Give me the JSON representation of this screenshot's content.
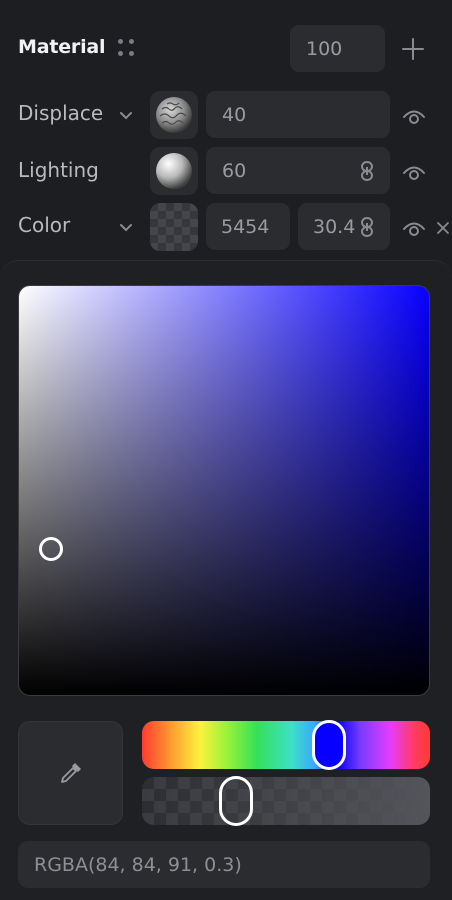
{
  "header": {
    "title": "Material",
    "value": "100"
  },
  "rows": [
    {
      "label": "Displace",
      "value": "40"
    },
    {
      "label": "Lighting",
      "value": "60"
    },
    {
      "label": "Color",
      "value": "5454",
      "opacity": "30.4"
    }
  ],
  "picker": {
    "hue_hex": "#0800FF",
    "current_color": "#54545B",
    "hue_position": 0.68,
    "alpha_position": 0.3,
    "sv_saturation": 0.08,
    "sv_value": 0.64,
    "rgba_text": "RGBA(84, 84, 91, 0.3)"
  },
  "icons": {
    "grip": "drag-grip-icon",
    "add": "plus-icon",
    "chevron": "chevron-down-icon",
    "visibility": "eye-icon",
    "link": "link-icon",
    "close": "close-icon",
    "eyedropper": "eyedropper-icon"
  }
}
